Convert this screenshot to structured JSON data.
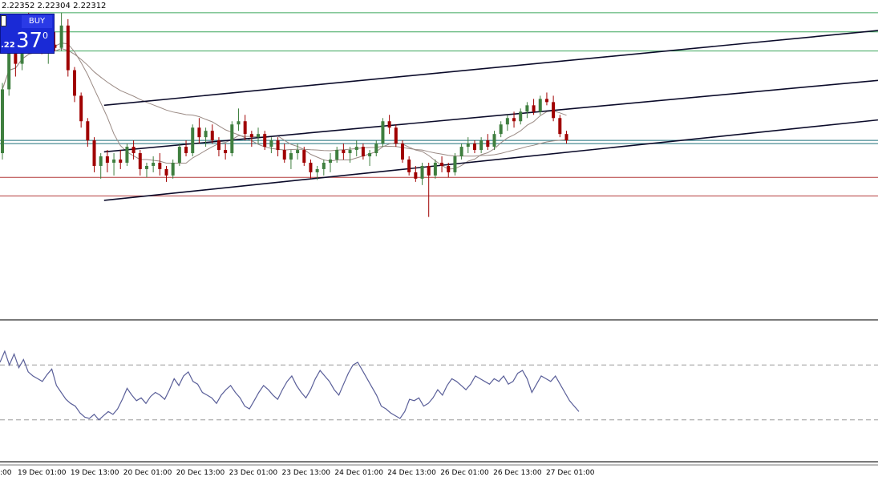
{
  "header": {
    "ohlc": "2.22352 2.22304 2.22312"
  },
  "trade_panel": {
    "buy_label": "BUY",
    "price_small": ".22",
    "price_big": "37",
    "price_sup": "0"
  },
  "colors": {
    "bull": "#3f7f3f",
    "bear": "#a00000",
    "resistance": "#3ca65c",
    "support": "#b33a3a",
    "channel": "#0b0b2a",
    "ma_fast": "#9a8a84",
    "ma_slow": "#9a8a84",
    "oscillator": "#5a5f99",
    "price_line": "#1f6f7a"
  },
  "chart_data": [
    {
      "type": "candlestick",
      "title": "",
      "x_tick_labels": [
        "19 Dec 01:00",
        "19 Dec 13:00",
        "20 Dec 01:00",
        "20 Dec 13:00",
        "23 Dec 01:00",
        "23 Dec 13:00",
        "24 Dec 01:00",
        "24 Dec 13:00",
        "26 Dec 01:00",
        "26 Dec 13:00",
        "27 Dec 01:00"
      ],
      "first_tick_fragment": ":00",
      "ylim": [
        2.195,
        2.245
      ],
      "horizontal_levels": [
        {
          "role": "resistance",
          "value": 2.243
        },
        {
          "role": "resistance",
          "value": 2.24
        },
        {
          "role": "resistance",
          "value": 2.237
        },
        {
          "role": "current",
          "value": 2.223
        },
        {
          "role": "current",
          "value": 2.2225
        },
        {
          "role": "support",
          "value": 2.2172
        },
        {
          "role": "support",
          "value": 2.2143
        }
      ],
      "channel_lines": [
        {
          "x": [
            10,
            107
          ],
          "y": [
            2.2285,
            2.2377
          ]
        },
        {
          "x": [
            10,
            107
          ],
          "y": [
            2.2212,
            2.23
          ]
        },
        {
          "x": [
            10,
            107
          ],
          "y": [
            2.2136,
            2.2235
          ]
        }
      ],
      "candles": [
        [
          2.221,
          2.232,
          2.22,
          2.231
        ],
        [
          2.231,
          2.239,
          2.23,
          2.237
        ],
        [
          2.237,
          2.241,
          2.233,
          2.235
        ],
        [
          2.235,
          2.242,
          2.234,
          2.24
        ],
        [
          2.24,
          2.243,
          2.238,
          2.2395
        ],
        [
          2.2395,
          2.2405,
          2.237,
          2.238
        ],
        [
          2.238,
          2.2395,
          2.2365,
          2.237
        ],
        [
          2.237,
          2.2385,
          2.235,
          2.238
        ],
        [
          2.238,
          2.24,
          2.237,
          2.2375
        ],
        [
          2.2375,
          2.243,
          2.237,
          2.241
        ],
        [
          2.241,
          2.242,
          2.233,
          2.234
        ],
        [
          2.234,
          2.2345,
          2.229,
          2.23
        ],
        [
          2.23,
          2.2305,
          2.225,
          2.226
        ],
        [
          2.226,
          2.2265,
          2.222,
          2.223
        ],
        [
          2.223,
          2.2235,
          2.218,
          2.219
        ],
        [
          2.219,
          2.221,
          2.217,
          2.2205
        ],
        [
          2.2205,
          2.2215,
          2.218,
          2.2195
        ],
        [
          2.2195,
          2.221,
          2.2175,
          2.22
        ],
        [
          2.22,
          2.2215,
          2.2185,
          2.2195
        ],
        [
          2.2195,
          2.2225,
          2.219,
          2.222
        ],
        [
          2.222,
          2.223,
          2.22,
          2.221
        ],
        [
          2.221,
          2.2215,
          2.2175,
          2.2185
        ],
        [
          2.2185,
          2.2195,
          2.2172,
          2.219
        ],
        [
          2.219,
          2.2205,
          2.218,
          2.2195
        ],
        [
          2.2195,
          2.221,
          2.2175,
          2.2185
        ],
        [
          2.2185,
          2.219,
          2.2165,
          2.2175
        ],
        [
          2.2175,
          2.22,
          2.217,
          2.2195
        ],
        [
          2.2195,
          2.2225,
          2.219,
          2.222
        ],
        [
          2.222,
          2.223,
          2.2205,
          2.221
        ],
        [
          2.221,
          2.2255,
          2.2205,
          2.225
        ],
        [
          2.225,
          2.2265,
          2.2225,
          2.2235
        ],
        [
          2.2235,
          2.225,
          2.222,
          2.2245
        ],
        [
          2.2245,
          2.2255,
          2.2225,
          2.223
        ],
        [
          2.223,
          2.2235,
          2.2205,
          2.2215
        ],
        [
          2.2215,
          2.2225,
          2.22,
          2.221
        ],
        [
          2.221,
          2.226,
          2.2205,
          2.2255
        ],
        [
          2.2255,
          2.228,
          2.2245,
          2.226
        ],
        [
          2.226,
          2.227,
          2.223,
          2.224
        ],
        [
          2.224,
          2.2245,
          2.222,
          2.2235
        ],
        [
          2.2235,
          2.225,
          2.2225,
          2.224
        ],
        [
          2.224,
          2.2245,
          2.2215,
          2.222
        ],
        [
          2.222,
          2.2235,
          2.221,
          2.223
        ],
        [
          2.223,
          2.2235,
          2.2205,
          2.2215
        ],
        [
          2.2215,
          2.2225,
          2.2195,
          2.22
        ],
        [
          2.22,
          2.2215,
          2.2185,
          2.221
        ],
        [
          2.221,
          2.2225,
          2.22,
          2.2215
        ],
        [
          2.2215,
          2.222,
          2.219,
          2.2195
        ],
        [
          2.2195,
          2.22,
          2.217,
          2.218
        ],
        [
          2.218,
          2.219,
          2.2168,
          2.2185
        ],
        [
          2.2185,
          2.22,
          2.2175,
          2.2195
        ],
        [
          2.2195,
          2.221,
          2.218,
          2.22
        ],
        [
          2.22,
          2.222,
          2.2195,
          2.2215
        ],
        [
          2.2215,
          2.2225,
          2.22,
          2.221
        ],
        [
          2.221,
          2.222,
          2.2195,
          2.2215
        ],
        [
          2.2215,
          2.223,
          2.2205,
          2.222
        ],
        [
          2.222,
          2.2225,
          2.22,
          2.2205
        ],
        [
          2.2205,
          2.2215,
          2.219,
          2.221
        ],
        [
          2.221,
          2.223,
          2.2205,
          2.2225
        ],
        [
          2.2225,
          2.2265,
          2.222,
          2.226
        ],
        [
          2.226,
          2.227,
          2.224,
          2.225
        ],
        [
          2.225,
          2.2255,
          2.222,
          2.2225
        ],
        [
          2.2225,
          2.223,
          2.2195,
          2.22
        ],
        [
          2.22,
          2.2205,
          2.2175,
          2.218
        ],
        [
          2.218,
          2.219,
          2.2165,
          2.217
        ],
        [
          2.217,
          2.2195,
          2.216,
          2.219
        ],
        [
          2.219,
          2.2195,
          2.211,
          2.2175
        ],
        [
          2.2175,
          2.22,
          2.217,
          2.2195
        ],
        [
          2.2195,
          2.2205,
          2.218,
          2.219
        ],
        [
          2.219,
          2.2195,
          2.2172,
          2.218
        ],
        [
          2.218,
          2.221,
          2.2175,
          2.2205
        ],
        [
          2.2205,
          2.2225,
          2.22,
          2.222
        ],
        [
          2.222,
          2.2235,
          2.221,
          2.2225
        ],
        [
          2.2225,
          2.223,
          2.221,
          2.2215
        ],
        [
          2.2215,
          2.2235,
          2.221,
          2.223
        ],
        [
          2.223,
          2.224,
          2.2215,
          2.222
        ],
        [
          2.222,
          2.2245,
          2.2215,
          2.224
        ],
        [
          2.224,
          2.226,
          2.2235,
          2.2255
        ],
        [
          2.2255,
          2.227,
          2.2245,
          2.2265
        ],
        [
          2.2265,
          2.2275,
          2.225,
          2.226
        ],
        [
          2.226,
          2.228,
          2.2255,
          2.2275
        ],
        [
          2.2275,
          2.229,
          2.2265,
          2.2285
        ],
        [
          2.2285,
          2.2295,
          2.227,
          2.2275
        ],
        [
          2.2275,
          2.23,
          2.227,
          2.2295
        ],
        [
          2.2295,
          2.2305,
          2.2285,
          2.229
        ],
        [
          2.229,
          2.23,
          2.226,
          2.2265
        ],
        [
          2.2265,
          2.227,
          2.2235,
          2.224
        ],
        [
          2.224,
          2.2245,
          2.2225,
          2.223
        ]
      ]
    },
    {
      "type": "line",
      "title": "",
      "ylim": [
        0,
        100
      ],
      "levels": [
        70,
        30
      ],
      "values": [
        72,
        80,
        70,
        78,
        68,
        74,
        65,
        62,
        60,
        58,
        63,
        67,
        55,
        50,
        45,
        42,
        40,
        35,
        32,
        31,
        34,
        30,
        33,
        36,
        34,
        38,
        45,
        53,
        48,
        44,
        46,
        42,
        47,
        50,
        48,
        45,
        52,
        60,
        55,
        62,
        65,
        58,
        56,
        50,
        48,
        46,
        42,
        48,
        52,
        55,
        50,
        46,
        40,
        38,
        44,
        50,
        55,
        52,
        48,
        45,
        52,
        58,
        62,
        55,
        50,
        46,
        52,
        60,
        66,
        62,
        58,
        52,
        48,
        56,
        64,
        70,
        72,
        66,
        60,
        54,
        48,
        40,
        38,
        35,
        33,
        31,
        36,
        45,
        44,
        46,
        40,
        42,
        46,
        52,
        48,
        55,
        60,
        58,
        55,
        52,
        56,
        62,
        60,
        58,
        56,
        60,
        58,
        62,
        56,
        58,
        64,
        66,
        60,
        50,
        56,
        62,
        60,
        58,
        62,
        56,
        50,
        44,
        40,
        36
      ]
    }
  ]
}
